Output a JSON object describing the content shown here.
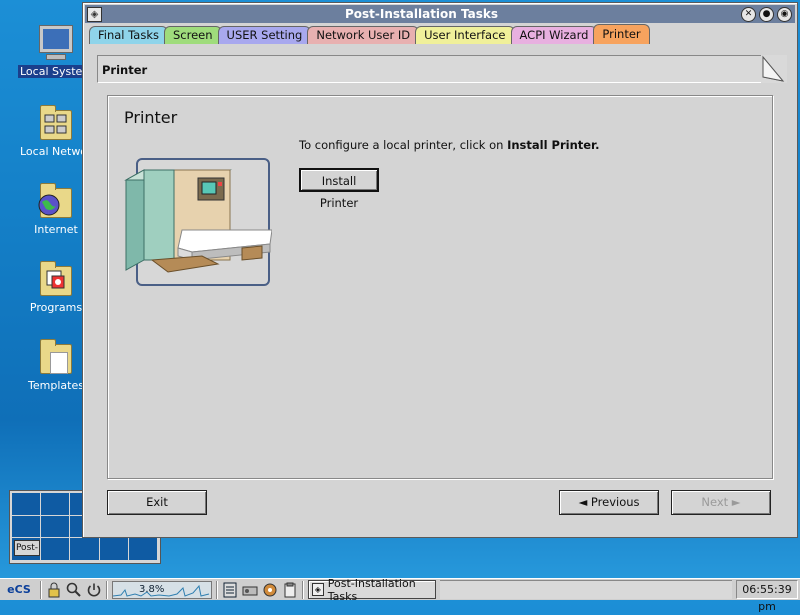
{
  "desktop": {
    "icons": [
      {
        "label": "Local System"
      },
      {
        "label": "Local Network"
      },
      {
        "label": "Internet"
      },
      {
        "label": "Programs"
      },
      {
        "label": "Templates"
      }
    ]
  },
  "window": {
    "title": "Post-Installation Tasks",
    "tabs": [
      {
        "label": "Final Tasks",
        "color": "#8fd4ea"
      },
      {
        "label": "Screen",
        "color": "#9fdc7c"
      },
      {
        "label": "USER Setting",
        "color": "#a8a8ee"
      },
      {
        "label": "Network User ID",
        "color": "#e8b0b0"
      },
      {
        "label": "User Interface",
        "color": "#f0f09a"
      },
      {
        "label": "ACPI Wizard",
        "color": "#e8b0e0"
      },
      {
        "label": "Printer",
        "color": "#f7a35e"
      }
    ],
    "active_tab": "Printer"
  },
  "panel": {
    "header": "Printer",
    "heading": "Printer",
    "instruction_prefix": "To configure a local printer, click on ",
    "instruction_bold": "Install Printer.",
    "install_button": "Install Printer"
  },
  "footer": {
    "exit": "Exit",
    "previous": "◄ Previous",
    "next": "Next ►"
  },
  "pager": {
    "mini_window_label": "Post-"
  },
  "taskbar": {
    "start_label": "eCS",
    "cpu_percent": "3.8%",
    "task_label": "Post-Installation Tasks",
    "clock": "06:55:39 pm"
  },
  "colors": {
    "desktop": "#1480c8",
    "title_bar": "#6c7f9e",
    "active_tab": "#f7a35e"
  }
}
